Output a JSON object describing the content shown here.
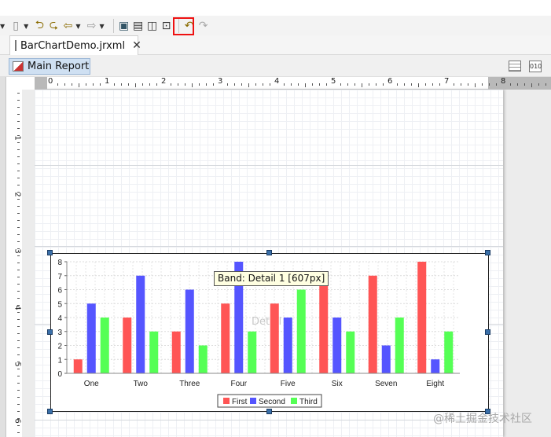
{
  "editor": {
    "tab_title": "BarChartDemo.jrxml",
    "sub_tab": "Main Report",
    "tooltip": "Band: Detail 1 [607px]",
    "band_ghost_label": "Detail"
  },
  "toolbar": {
    "icons": [
      "pan-icon",
      "dropdown-icon",
      "undo-icon",
      "redo-icon",
      "back-icon",
      "forward-icon",
      "add-element-icon",
      "band-icon",
      "align-icon",
      "select-icon",
      "prev-icon",
      "next-icon"
    ]
  },
  "ruler": {
    "h_labels": [
      "0",
      "1",
      "2",
      "3",
      "4",
      "5",
      "6",
      "7",
      "8"
    ],
    "v_labels": [
      "1",
      "2",
      "3",
      "4",
      "5",
      "6"
    ]
  },
  "watermark": "@稀土掘金技术社区",
  "colors": {
    "first": "#ff5555",
    "second": "#5555ff",
    "third": "#55ff55",
    "handle": "#3a6fa8"
  },
  "chart_data": {
    "type": "bar",
    "categories": [
      "One",
      "Two",
      "Three",
      "Four",
      "Five",
      "Six",
      "Seven",
      "Eight"
    ],
    "series": [
      {
        "name": "First",
        "values": [
          1,
          4,
          3,
          5,
          5,
          7,
          7,
          8
        ]
      },
      {
        "name": "Second",
        "values": [
          5,
          7,
          6,
          8,
          4,
          4,
          2,
          1
        ]
      },
      {
        "name": "Third",
        "values": [
          4,
          3,
          2,
          3,
          6,
          3,
          4,
          3
        ]
      }
    ],
    "yticks": [
      "0",
      "1",
      "2",
      "3",
      "4",
      "5",
      "6",
      "7",
      "8"
    ],
    "ylim": [
      0,
      8
    ],
    "grid": true,
    "legend": "bottom-center"
  }
}
